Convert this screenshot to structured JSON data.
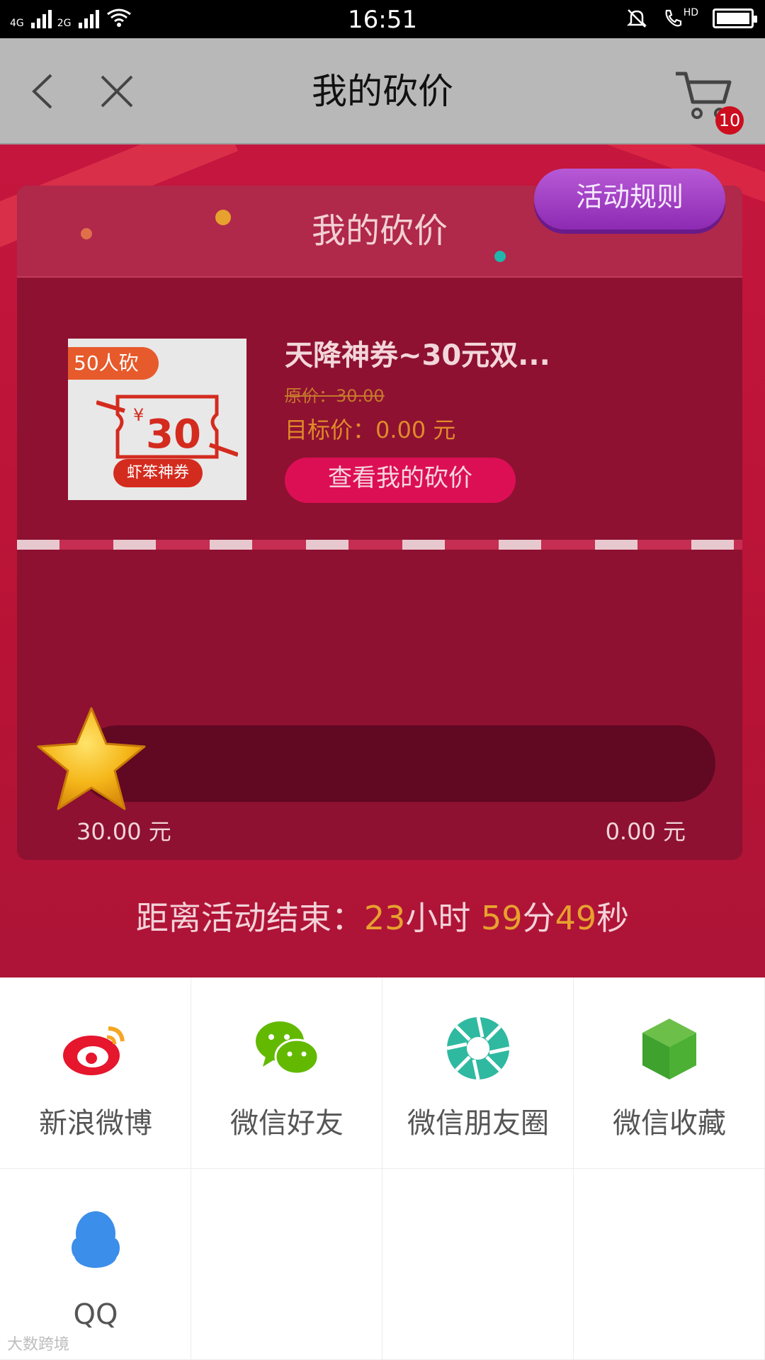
{
  "status_bar": {
    "network1": "4G",
    "network2": "2G",
    "time": "16:51",
    "hd_label": "HD"
  },
  "nav": {
    "title": "我的砍价",
    "cart_count": "10",
    "icons": [
      "back-chevron-icon",
      "close-icon",
      "cart-icon"
    ]
  },
  "panel": {
    "title": "我的砍价",
    "rules_button": "活动规则"
  },
  "product": {
    "tag": "50人砍",
    "coupon_symbol": "¥",
    "coupon_amount": "30",
    "coupon_brand": "虾笨神券",
    "name": "天降神券~30元双...",
    "original_price": "原价：30.00",
    "target_price": "目标价：0.00 元",
    "view_button": "查看我的砍价"
  },
  "progress": {
    "start_label": "30.00 元",
    "end_label": "0.00 元",
    "fraction_bargained": 0
  },
  "countdown": {
    "prefix": "距离活动结束：",
    "hours": "23",
    "hours_unit": "小时 ",
    "minutes": "59",
    "minutes_unit": "分",
    "seconds": "49",
    "seconds_unit": "秒"
  },
  "share": {
    "items": [
      {
        "label": "新浪微博",
        "icon": "weibo-icon",
        "color": "#e6162d"
      },
      {
        "label": "微信好友",
        "icon": "wechat-icon",
        "color": "#62b900"
      },
      {
        "label": "微信朋友圈",
        "icon": "moments-icon",
        "color": "#2fb9a0"
      },
      {
        "label": "微信收藏",
        "icon": "wechat-favorites-icon",
        "color": "#4cb035"
      },
      {
        "label": "QQ",
        "icon": "qq-icon",
        "color": "#3b8ee9"
      }
    ]
  },
  "watermark": "大数跨境"
}
